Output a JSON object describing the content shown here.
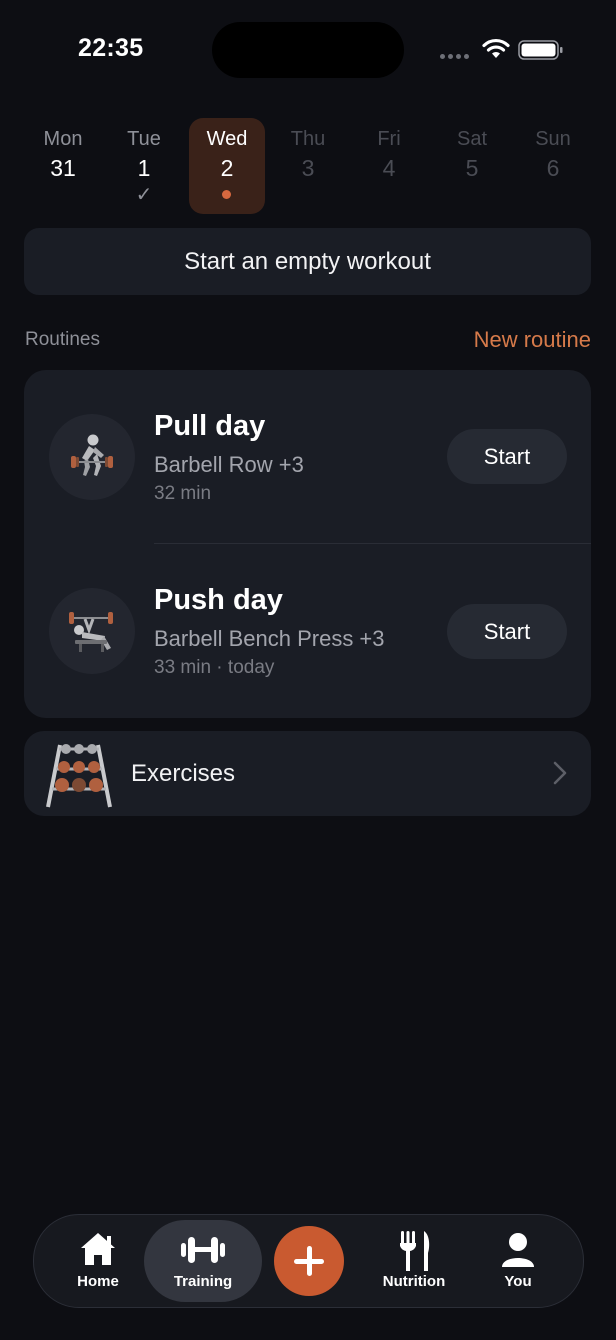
{
  "status": {
    "time": "22:35"
  },
  "week": [
    {
      "name": "Mon",
      "num": "31",
      "state": "past"
    },
    {
      "name": "Tue",
      "num": "1",
      "state": "done",
      "mark": "✓"
    },
    {
      "name": "Wed",
      "num": "2",
      "state": "selected"
    },
    {
      "name": "Thu",
      "num": "3",
      "state": "future"
    },
    {
      "name": "Fri",
      "num": "4",
      "state": "future"
    },
    {
      "name": "Sat",
      "num": "5",
      "state": "future"
    },
    {
      "name": "Sun",
      "num": "6",
      "state": "future"
    }
  ],
  "empty_workout_label": "Start an empty workout",
  "routines": {
    "section_label": "Routines",
    "new_routine_label": "New routine",
    "items": [
      {
        "title": "Pull day",
        "subtitle": "Barbell Row +3",
        "meta": "32 min",
        "start_label": "Start",
        "icon": "barbell-row-icon"
      },
      {
        "title": "Push day",
        "subtitle": "Barbell Bench Press +3",
        "meta": "33 min · today",
        "start_label": "Start",
        "icon": "bench-press-icon"
      }
    ]
  },
  "exercises": {
    "label": "Exercises",
    "icon": "dumbbell-rack-icon"
  },
  "tabbar": {
    "home": "Home",
    "training": "Training",
    "nutrition": "Nutrition",
    "you": "You"
  },
  "colors": {
    "background": "#0d0e13",
    "card": "#1a1d25",
    "accent": "#d6683f",
    "accent_text": "#d67a4a",
    "selected_day": "#3a2219"
  }
}
